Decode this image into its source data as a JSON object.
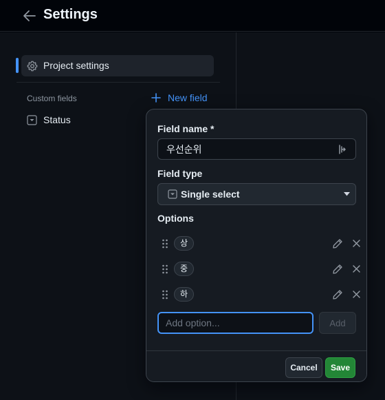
{
  "header": {
    "title": "Settings"
  },
  "sidebar": {
    "active_item": "Project settings",
    "section_label": "Custom fields",
    "new_field_label": "New field",
    "fields": [
      {
        "label": "Status"
      }
    ]
  },
  "modal": {
    "field_name_label": "Field name *",
    "field_name_value": "우선순위",
    "field_type_label": "Field type",
    "field_type_value": "Single select",
    "options_label": "Options",
    "options": [
      {
        "label": "상"
      },
      {
        "label": "중"
      },
      {
        "label": "하"
      }
    ],
    "add_option_placeholder": "Add option...",
    "add_label": "Add",
    "cancel_label": "Cancel",
    "save_label": "Save"
  },
  "colors": {
    "accent": "#4493f8",
    "primary_button": "#238636",
    "background": "#0d1117"
  }
}
